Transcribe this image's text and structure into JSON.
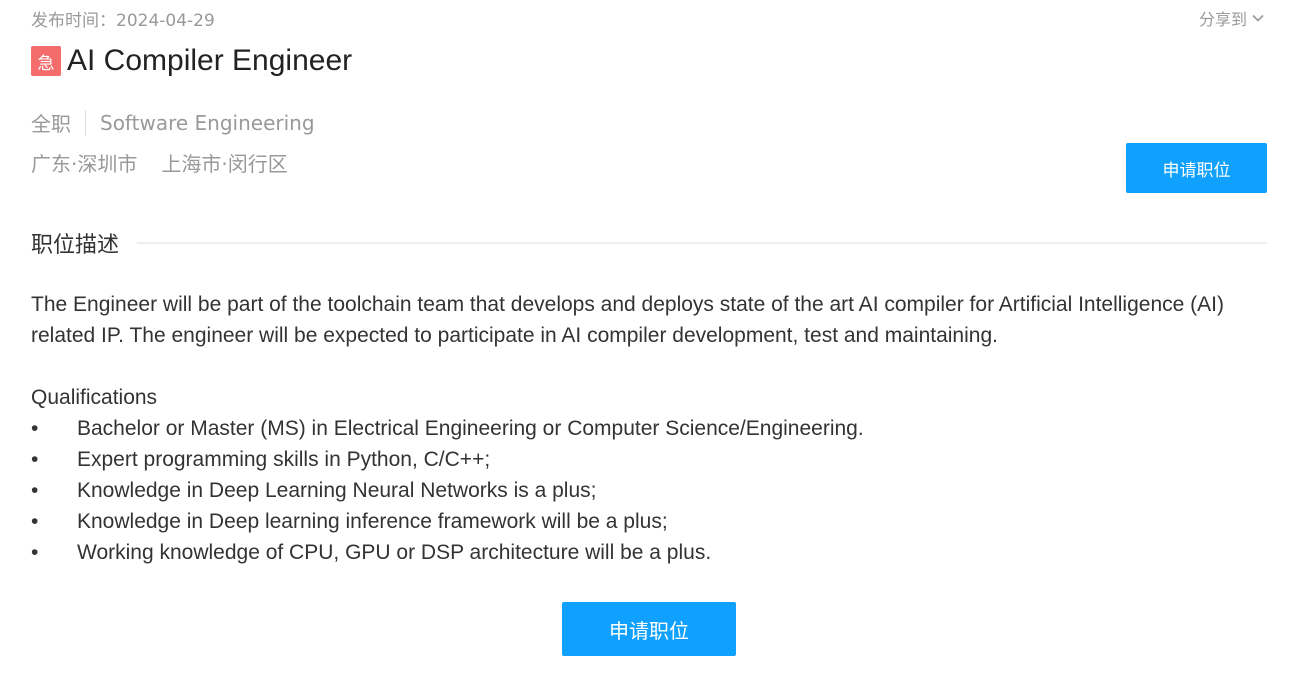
{
  "header": {
    "publish_date": "发布时间：2024-04-29",
    "share_label": "分享到",
    "share_icon": "chevron-down-icon"
  },
  "job": {
    "urgent_badge": "急",
    "title": "AI Compiler Engineer",
    "employment_type": "全职",
    "category": "Software Engineering",
    "locations": [
      "广东·深圳市",
      "上海市·闵行区"
    ],
    "apply_label": "申请职位"
  },
  "description": {
    "heading": "职位描述",
    "summary": "The Engineer will be part of the toolchain team that develops and deploys state of the art AI compiler for Artificial Intelligence (AI) related IP. The engineer will be expected to participate in AI compiler development, test and maintaining.",
    "qualifications_heading": "Qualifications",
    "bullet": "•",
    "qualifications": [
      "Bachelor or Master (MS) in Electrical Engineering or Computer Science/Engineering.",
      "Expert programming skills in Python, C/C++;",
      "Knowledge in Deep Learning Neural Networks is a plus;",
      "Knowledge in Deep learning inference framework will be a plus;",
      "Working knowledge of CPU, GPU or DSP architecture will be a plus."
    ]
  },
  "footer": {
    "apply_label": "申请职位"
  },
  "colors": {
    "accent": "#10a0fe",
    "urgent": "#f56c6c",
    "muted_text": "#999999",
    "body_text": "#333333"
  }
}
